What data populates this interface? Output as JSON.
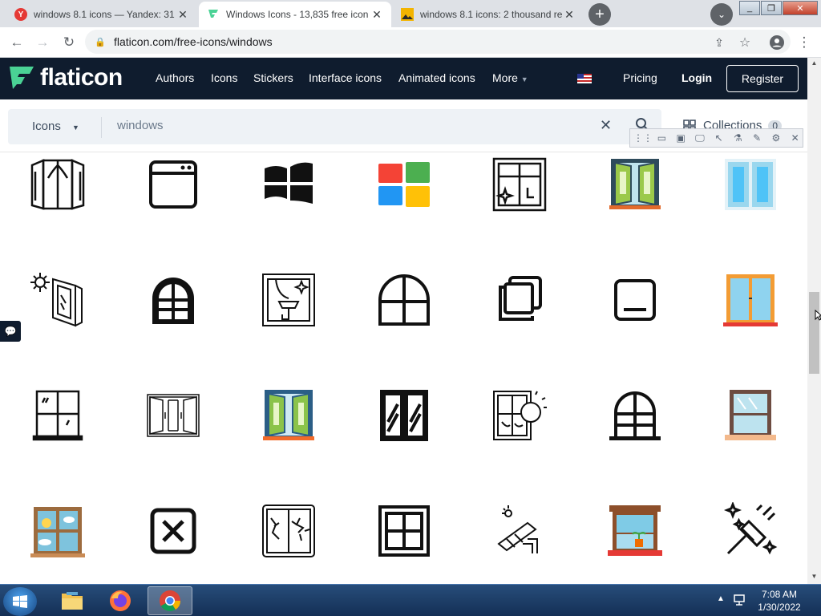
{
  "browser": {
    "tabs": [
      {
        "title": "windows 8.1 icons — Yandex: 31",
        "favicon": "yandex-icon",
        "active": false
      },
      {
        "title": "Windows Icons - 13,835 free icon",
        "favicon": "flaticon-icon",
        "active": true
      },
      {
        "title": "windows 8.1 icons: 2 thousand re",
        "favicon": "image-search-icon",
        "active": false
      }
    ],
    "new_tab_label": "+",
    "close_glyph": "✕",
    "url": "flaticon.com/free-icons/windows"
  },
  "site": {
    "brand": "flaticon",
    "nav": [
      "Authors",
      "Icons",
      "Stickers",
      "Interface icons",
      "Animated icons",
      "More"
    ],
    "pricing": "Pricing",
    "login": "Login",
    "register": "Register",
    "colors": {
      "header_bg": "#0f1c2e",
      "brand_green": "#4ad295"
    }
  },
  "search": {
    "type": "Icons",
    "query": "windows",
    "collections_label": "Collections",
    "collections_count": "0"
  },
  "icons": [
    "open-casement-window-icon",
    "browser-window-icon",
    "windows-logo-icon",
    "microsoft-logo-icon",
    "clean-window-icon",
    "open-green-window-icon",
    "glass-window-icon",
    "window-sun-icon",
    "arched-window-icon",
    "window-cleaning-icon",
    "arched-window-outline-icon",
    "restore-window-icon",
    "minimize-window-icon",
    "orange-window-icon",
    "four-pane-window-icon",
    "double-window-icon",
    "open-blue-window-icon",
    "shutter-window-icon",
    "window-sun-outline-icon",
    "arched-window-sill-icon",
    "sash-window-icon",
    "weather-window-icon",
    "close-box-icon",
    "broken-window-icon",
    "square-window-icon",
    "window-glass-cleaning-icon",
    "window-plant-icon",
    "squeegee-sparkle-icon"
  ],
  "taskbar": {
    "apps": [
      "file-explorer-icon",
      "firefox-icon",
      "chrome-icon"
    ],
    "time": "7:08 AM",
    "date": "1/30/2022"
  }
}
